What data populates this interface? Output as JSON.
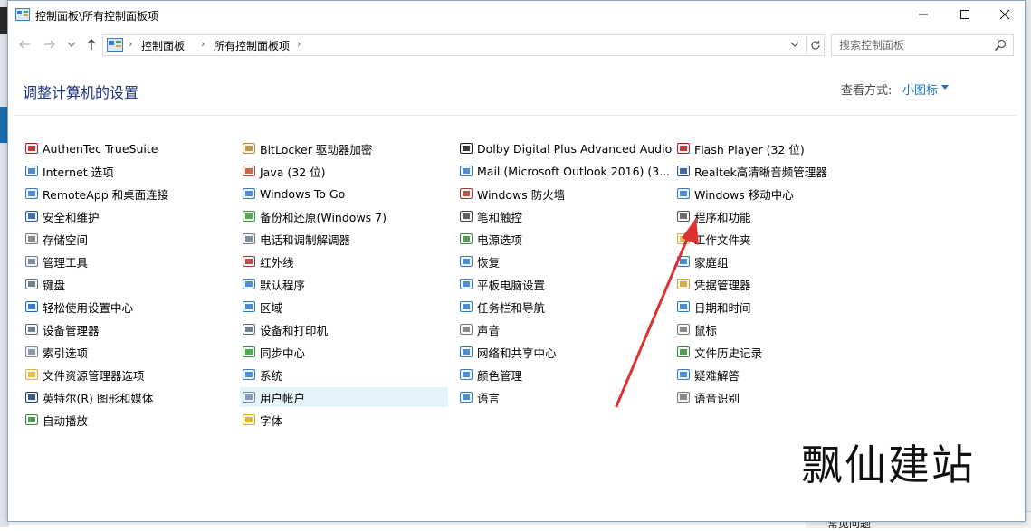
{
  "window": {
    "title": "控制面板\\所有控制面板项",
    "colors": {
      "accent": "#1a73c8",
      "heading": "#1e3287",
      "arrow": "#e03131",
      "selected_bg": "#e5f3fb"
    }
  },
  "address": {
    "crumbs": [
      "控制面板",
      "所有控制面板项"
    ],
    "search_placeholder": "搜索控制面板"
  },
  "header": {
    "title": "调整计算机的设置",
    "view_by_label": "查看方式:",
    "view_by_value": "小图标"
  },
  "columns": [
    {
      "items": [
        {
          "label": "AuthenTec TrueSuite",
          "icon": "fingerprint-icon"
        },
        {
          "label": "Internet 选项",
          "icon": "internet-options-icon"
        },
        {
          "label": "RemoteApp 和桌面连接",
          "icon": "remoteapp-icon"
        },
        {
          "label": "安全和维护",
          "icon": "security-flag-icon"
        },
        {
          "label": "存储空间",
          "icon": "storage-icon"
        },
        {
          "label": "管理工具",
          "icon": "admin-tools-icon"
        },
        {
          "label": "键盘",
          "icon": "keyboard-icon"
        },
        {
          "label": "轻松使用设置中心",
          "icon": "ease-of-access-icon"
        },
        {
          "label": "设备管理器",
          "icon": "device-manager-icon"
        },
        {
          "label": "索引选项",
          "icon": "indexing-icon"
        },
        {
          "label": "文件资源管理器选项",
          "icon": "folder-options-icon"
        },
        {
          "label": "英特尔(R) 图形和媒体",
          "icon": "intel-graphics-icon"
        },
        {
          "label": "自动播放",
          "icon": "autoplay-icon"
        }
      ]
    },
    {
      "items": [
        {
          "label": "BitLocker 驱动器加密",
          "icon": "bitlocker-icon"
        },
        {
          "label": "Java (32 位)",
          "icon": "java-icon"
        },
        {
          "label": "Windows To Go",
          "icon": "windows-to-go-icon"
        },
        {
          "label": "备份和还原(Windows 7)",
          "icon": "backup-icon"
        },
        {
          "label": "电话和调制解调器",
          "icon": "phone-modem-icon"
        },
        {
          "label": "红外线",
          "icon": "infrared-icon"
        },
        {
          "label": "默认程序",
          "icon": "default-programs-icon"
        },
        {
          "label": "区域",
          "icon": "region-icon"
        },
        {
          "label": "设备和打印机",
          "icon": "printer-icon"
        },
        {
          "label": "同步中心",
          "icon": "sync-icon"
        },
        {
          "label": "系统",
          "icon": "system-icon"
        },
        {
          "label": "用户帐户",
          "icon": "user-accounts-icon",
          "selected": true
        },
        {
          "label": "字体",
          "icon": "fonts-icon"
        }
      ]
    },
    {
      "items": [
        {
          "label": "Dolby Digital Plus Advanced Audio",
          "icon": "dolby-icon"
        },
        {
          "label": "Mail (Microsoft Outlook 2016) (3...",
          "icon": "mail-icon"
        },
        {
          "label": "Windows 防火墙",
          "icon": "firewall-icon"
        },
        {
          "label": "笔和触控",
          "icon": "pen-icon"
        },
        {
          "label": "电源选项",
          "icon": "power-icon"
        },
        {
          "label": "恢复",
          "icon": "recovery-icon"
        },
        {
          "label": "平板电脑设置",
          "icon": "tablet-icon"
        },
        {
          "label": "任务栏和导航",
          "icon": "taskbar-icon"
        },
        {
          "label": "声音",
          "icon": "sound-icon"
        },
        {
          "label": "网络和共享中心",
          "icon": "network-icon"
        },
        {
          "label": "颜色管理",
          "icon": "color-management-icon"
        },
        {
          "label": "语言",
          "icon": "language-icon"
        }
      ]
    },
    {
      "items": [
        {
          "label": "Flash Player (32 位)",
          "icon": "flash-icon"
        },
        {
          "label": "Realtek高清晰音频管理器",
          "icon": "realtek-icon"
        },
        {
          "label": "Windows 移动中心",
          "icon": "mobility-center-icon"
        },
        {
          "label": "程序和功能",
          "icon": "programs-features-icon"
        },
        {
          "label": "工作文件夹",
          "icon": "work-folders-icon"
        },
        {
          "label": "家庭组",
          "icon": "homegroup-icon"
        },
        {
          "label": "凭据管理器",
          "icon": "credential-icon"
        },
        {
          "label": "日期和时间",
          "icon": "datetime-icon"
        },
        {
          "label": "鼠标",
          "icon": "mouse-icon"
        },
        {
          "label": "文件历史记录",
          "icon": "file-history-icon"
        },
        {
          "label": "疑难解答",
          "icon": "troubleshoot-icon"
        },
        {
          "label": "语音识别",
          "icon": "speech-icon"
        }
      ]
    }
  ],
  "watermark": "飘仙建站",
  "background_snippet": "常见问题"
}
